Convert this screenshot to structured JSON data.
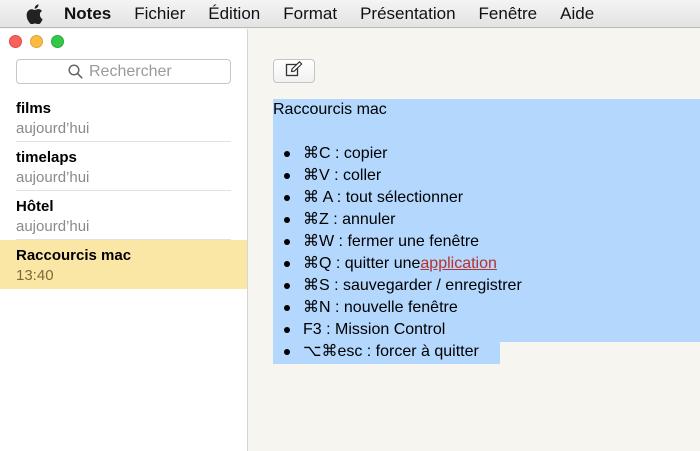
{
  "menubar": {
    "app_name": "Notes",
    "items": [
      "Fichier",
      "Édition",
      "Format",
      "Présentation",
      "Fenêtre",
      "Aide"
    ]
  },
  "search": {
    "placeholder": "Rechercher"
  },
  "notes": [
    {
      "title": "films",
      "date": "aujourd’hui"
    },
    {
      "title": "timelaps",
      "date": "aujourd’hui"
    },
    {
      "title": "Hôtel",
      "date": "aujourd’hui"
    },
    {
      "title": "Raccourcis mac",
      "date": "13:40",
      "selected": true
    }
  ],
  "editor": {
    "title": "Raccourcis mac",
    "items": [
      {
        "text": "⌘C : copier"
      },
      {
        "text": "⌘V : coller"
      },
      {
        "text": "⌘ A : tout sélectionner"
      },
      {
        "text": "⌘Z : annuler"
      },
      {
        "text": "⌘W : fermer une fenêtre"
      },
      {
        "prefix": "⌘Q : quitter une ",
        "link": "application"
      },
      {
        "text": "⌘S : sauvegarder / enregistrer"
      },
      {
        "text": "⌘N : nouvelle fenêtre"
      },
      {
        "text": "F3 : Mission Control"
      },
      {
        "text": "⌥⌘esc : forcer à quitter"
      }
    ]
  },
  "colors": {
    "selection": "#b3d7fd",
    "selected_note": "#fbe7a5",
    "link": "#b8312f",
    "close": "#fc605c",
    "minimize": "#fdbc40",
    "zoom": "#34c84a"
  },
  "icons": [
    "apple-icon",
    "search-icon",
    "compose-icon"
  ]
}
